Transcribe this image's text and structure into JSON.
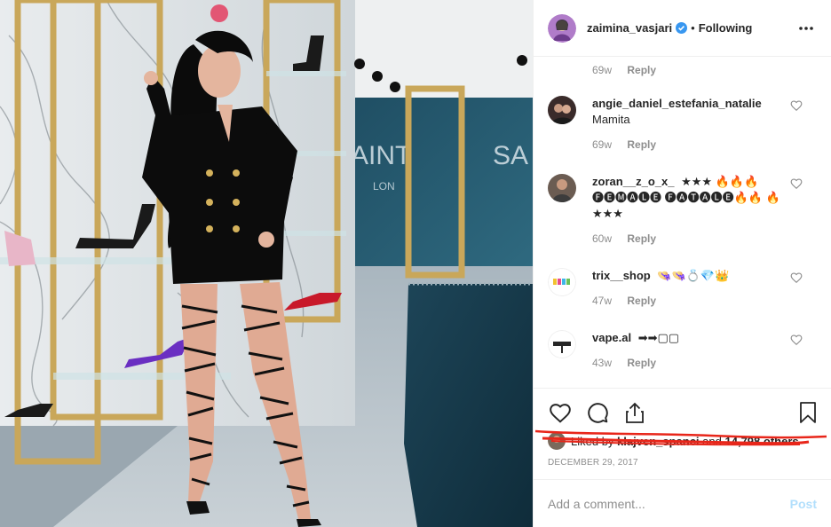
{
  "post": {
    "image_alt": "Woman in black blazer dress and lace-up heels in a shoe boutique"
  },
  "header": {
    "username": "zaimina_vasjari",
    "verified_icon": "verified-badge-icon",
    "separator": "•",
    "follow_status": "Following",
    "more_icon": "more-options-icon"
  },
  "top_meta": {
    "time": "69w",
    "reply": "Reply"
  },
  "comments": [
    {
      "user": "angie_daniel_estefania_natalie",
      "text": "Mamita",
      "time": "69w",
      "reply": "Reply"
    },
    {
      "user": "zoran__z_o_x_",
      "text": "★★★ 🔥🔥🔥 🅕🅔🅜🅐🅛🅔 🅕🅐🅣🅐🅛🅔🔥🔥 🔥 ★★★",
      "time": "60w",
      "reply": "Reply"
    },
    {
      "user": "trix__shop",
      "text": "👒👒💍💎👑",
      "time": "47w",
      "reply": "Reply"
    },
    {
      "user": "vape.al",
      "text": "➡➡▢▢",
      "time": "43w",
      "reply": "Reply"
    }
  ],
  "actions": {
    "like_icon": "heart-icon",
    "comment_icon": "comment-icon",
    "share_icon": "share-icon",
    "save_icon": "bookmark-icon"
  },
  "likes": {
    "prefix": "Liked by",
    "user": "klajven_spanci",
    "middle": "and",
    "count": "14,798 others"
  },
  "date": "DECEMBER 29, 2017",
  "add_comment": {
    "placeholder": "Add a comment...",
    "post_label": "Post"
  },
  "colors": {
    "link": "#0095f6",
    "post_disabled": "#b2dffc",
    "verified": "#3897f0",
    "scribble": "#e8261a"
  }
}
